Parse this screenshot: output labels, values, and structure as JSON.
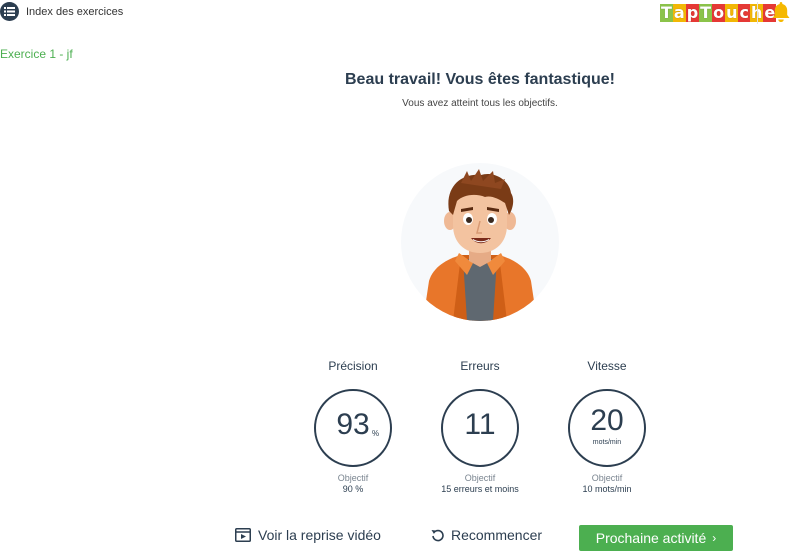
{
  "header": {
    "index_label": "Index des exercices",
    "logo_letters": [
      "T",
      "a",
      "p",
      "T",
      "o",
      "u",
      "c",
      "h",
      "e"
    ],
    "logo_colors": [
      "#8bc34a",
      "#f2b705",
      "#e53935",
      "#8bc34a",
      "#e53935",
      "#f2b705",
      "#e53935",
      "#f2b705",
      "#e53935"
    ]
  },
  "exercise": {
    "title": "Exercice 1 - jf"
  },
  "result": {
    "headline": "Beau travail! Vous êtes fantastique!",
    "subline": "Vous avez atteint tous les objectifs."
  },
  "stats": [
    {
      "label": "Précision",
      "value": "93",
      "unit": "%",
      "objective_title": "Objectif",
      "objective_value": "90 %"
    },
    {
      "label": "Erreurs",
      "value": "11",
      "unit": "",
      "objective_title": "Objectif",
      "objective_value": "15 erreurs et moins"
    },
    {
      "label": "Vitesse",
      "value": "20",
      "unit": "mots/min",
      "objective_title": "Objectif",
      "objective_value": "10 mots/min"
    }
  ],
  "actions": {
    "video_label": "Voir la reprise vidéo",
    "restart_label": "Recommencer",
    "next_label": "Prochaine activité"
  },
  "colors": {
    "accent": "#4caf50",
    "text": "#2c3e50",
    "bell": "#f5b800"
  }
}
